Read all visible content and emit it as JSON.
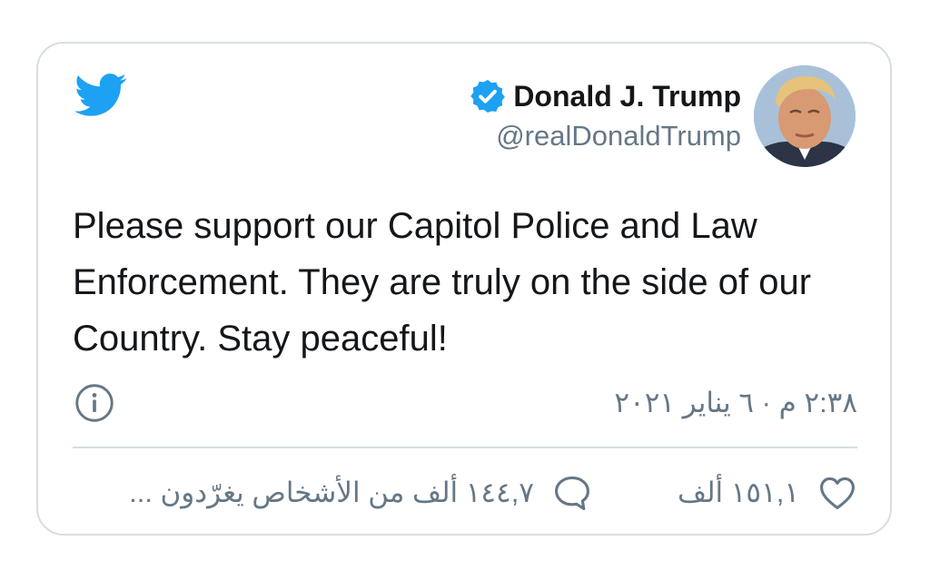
{
  "author": {
    "display_name": "Donald J. Trump",
    "handle": "@realDonaldTrump",
    "verified": true
  },
  "tweet": {
    "text": "Please support our Capitol Police and Law Enforcement. They are truly on the side of our Country. Stay peaceful!",
    "timestamp": "٢:٣٨ م · ٦ يناير ٢٠٢١"
  },
  "actions": {
    "likes_label": "١٥١,١ ألف",
    "reply_label": "١٤٤,٧ ألف من الأشخاص يغرّدون ..."
  },
  "icons": {
    "logo": "twitter-bird-icon",
    "verified": "verified-badge-icon",
    "info": "info-icon",
    "like": "heart-icon",
    "reply": "speech-bubble-icon"
  },
  "colors": {
    "twitter_blue": "#1da1f2",
    "text": "#14171a",
    "secondary": "#657786",
    "border": "#d6dee4"
  }
}
